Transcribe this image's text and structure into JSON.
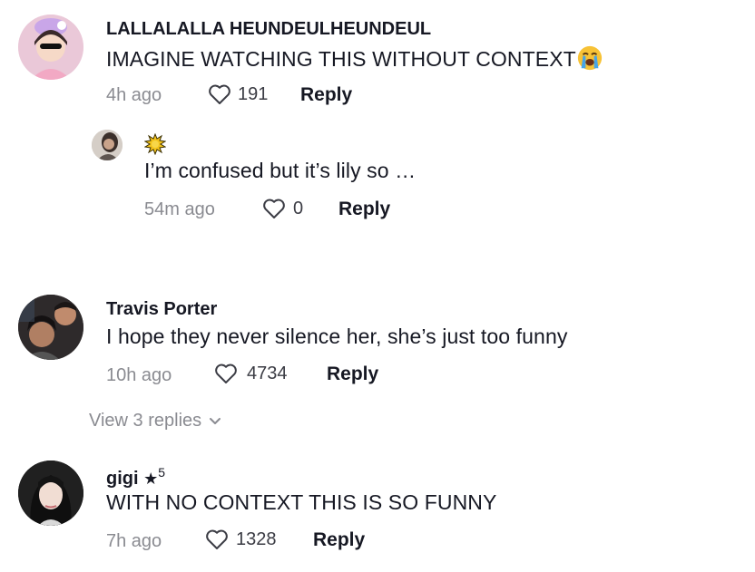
{
  "comments": [
    {
      "username": "LALLALALLA HEUNDEULHEUNDEUL",
      "text": "IMAGINE WATCHING THIS WITHOUT CONTEXT",
      "emoji": "loudly-crying-face-icon",
      "time": "4h ago",
      "likes": "191",
      "reply_label": "Reply"
    },
    {
      "username_icon": "sun-sticker-icon",
      "text": "I’m confused but it’s lily so …",
      "time": "54m ago",
      "likes": "0",
      "reply_label": "Reply"
    },
    {
      "username": "Travis Porter",
      "text": "I hope they never silence her, she’s just too funny",
      "time": "10h ago",
      "likes": "4734",
      "reply_label": "Reply",
      "view_replies": "View 3 replies"
    },
    {
      "username": "gigi",
      "badge": "★",
      "badge_sup": "5",
      "text": "WITH NO CONTEXT THIS IS SO FUNNY",
      "time": "7h ago",
      "likes": "1328",
      "reply_label": "Reply"
    }
  ],
  "colors": {
    "text_primary": "#161823",
    "text_secondary": "#8a8b91",
    "background": "#ffffff"
  }
}
